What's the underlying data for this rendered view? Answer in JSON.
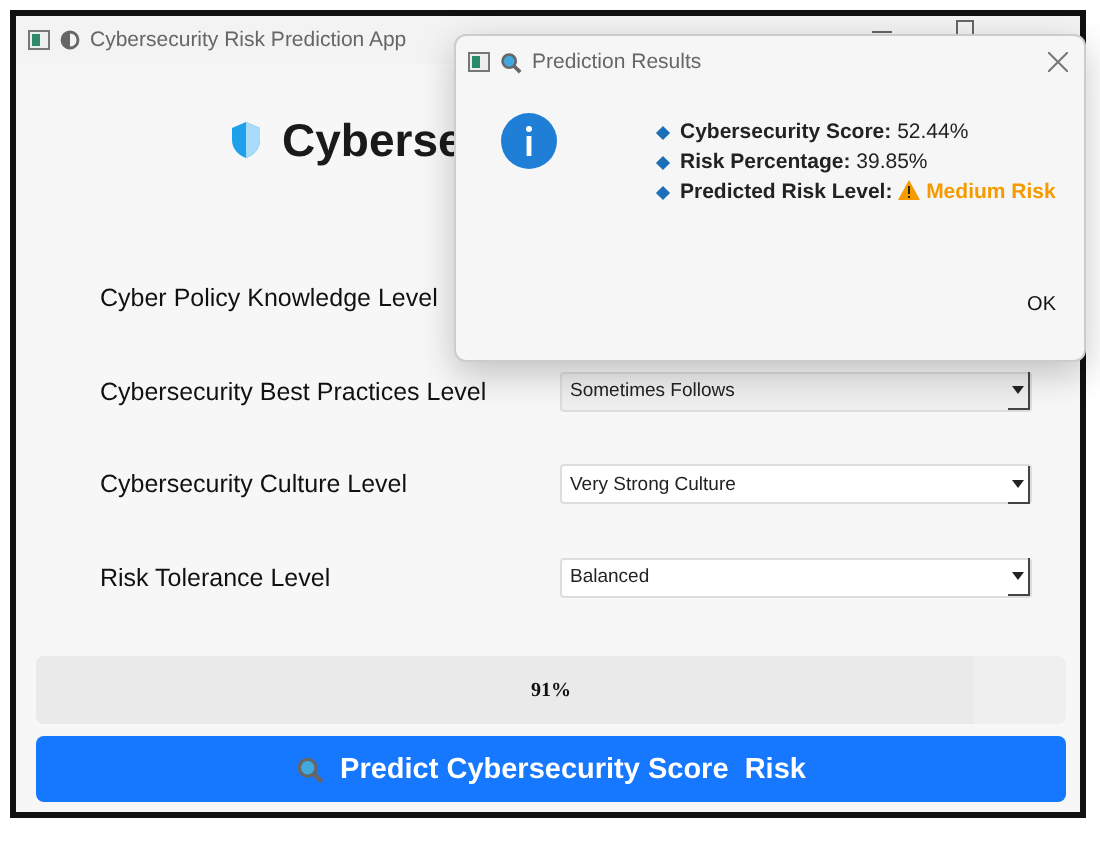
{
  "window": {
    "title": "Cybersecurity Risk Prediction App"
  },
  "heading": "Cyberse",
  "fields": [
    {
      "label": "Cyber Policy Knowledge Level"
    },
    {
      "label": "Cybersecurity Best Practices Level",
      "value": "Sometimes Follows",
      "selected": false
    },
    {
      "label": "Cybersecurity Culture Level",
      "value": "Very Strong Culture",
      "selected": true
    },
    {
      "label": "Risk Tolerance Level",
      "value": "Balanced",
      "selected": true
    }
  ],
  "progress": {
    "label": "91%",
    "level": 0.91
  },
  "predict_button": {
    "label": "Predict Cybersecurity Score  Risk"
  },
  "dialog": {
    "title": "Prediction Results",
    "results": [
      {
        "label": "Cybersecurity Score:",
        "value": "52.44%",
        "kind": "plain"
      },
      {
        "label": "Risk Percentage:",
        "value": "39.85%",
        "kind": "plain"
      },
      {
        "label": "Predicted Risk Level:",
        "value": "Medium Risk",
        "kind": "warning"
      }
    ],
    "button": "OK"
  }
}
